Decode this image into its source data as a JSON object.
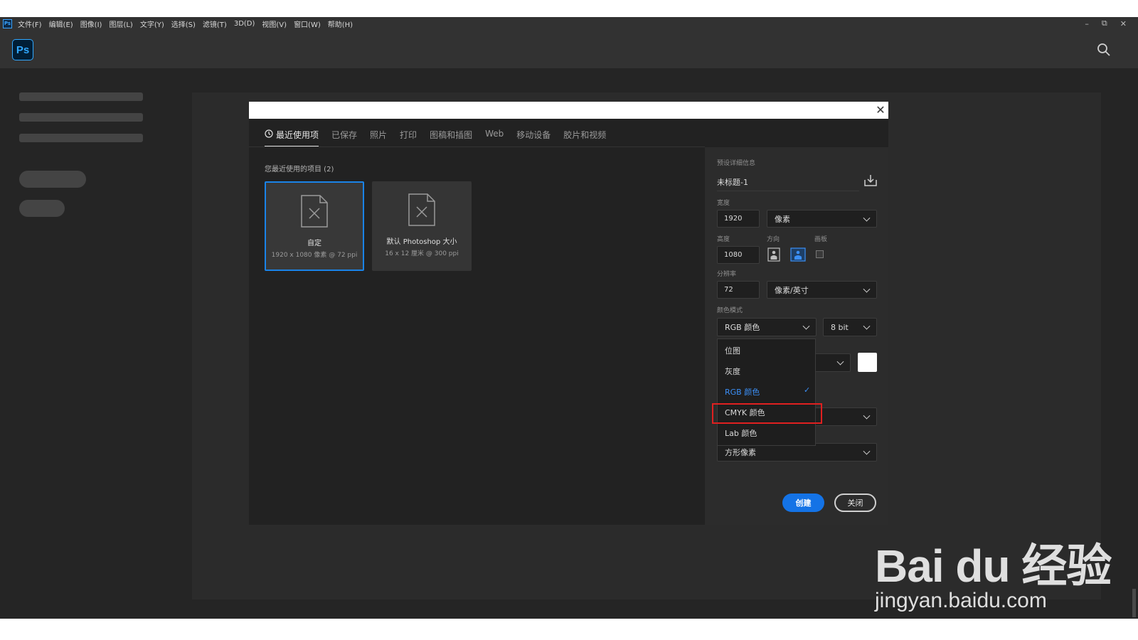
{
  "menubar": {
    "app_icon": "Ps",
    "items": [
      "文件(F)",
      "编辑(E)",
      "图像(I)",
      "图层(L)",
      "文字(Y)",
      "选择(S)",
      "滤镜(T)",
      "3D(D)",
      "视图(V)",
      "窗口(W)",
      "帮助(H)"
    ],
    "window_controls": [
      "–",
      "⧉",
      "✕"
    ]
  },
  "header": {
    "logo": "Ps",
    "search_icon": "search-icon"
  },
  "dialog": {
    "close_glyph": "✕",
    "tabs": [
      "最近使用项",
      "已保存",
      "照片",
      "打印",
      "图稿和插图",
      "Web",
      "移动设备",
      "胶片和视频"
    ],
    "active_tab": 0,
    "recent_title": "您最近使用的项目 (2)",
    "cards": [
      {
        "name": "自定",
        "sub": "1920 x 1080 像素 @ 72 ppi",
        "selected": true
      },
      {
        "name": "默认 Photoshop 大小",
        "sub": "16 x 12 厘米 @ 300 ppi",
        "selected": false
      }
    ]
  },
  "preset": {
    "section_label": "预设详细信息",
    "name": "未标题-1",
    "width_label": "宽度",
    "width_value": "1920",
    "width_unit": "像素",
    "height_label": "高度",
    "height_value": "1080",
    "orientation_label": "方向",
    "artboard_label": "画板",
    "resolution_label": "分辨率",
    "resolution_value": "72",
    "resolution_unit": "像素/英寸",
    "color_mode_label": "颜色模式",
    "color_mode_value": "RGB 颜色",
    "bit_depth": "8 bit",
    "pixel_aspect_value": "方形像素",
    "create_label": "创建",
    "close_label": "关闭"
  },
  "color_mode_menu": {
    "items": [
      "位图",
      "灰度",
      "RGB 颜色",
      "CMYK 颜色",
      "Lab 颜色"
    ],
    "selected": "RGB 颜色",
    "highlighted": "CMYK 颜色",
    "check_glyph": "✓"
  },
  "watermark": {
    "line1": "Bai du 经验",
    "line2": "jingyan.baidu.com"
  },
  "colors": {
    "accent": "#1473e6",
    "highlight_box": "#e02020",
    "background": "#252525"
  }
}
